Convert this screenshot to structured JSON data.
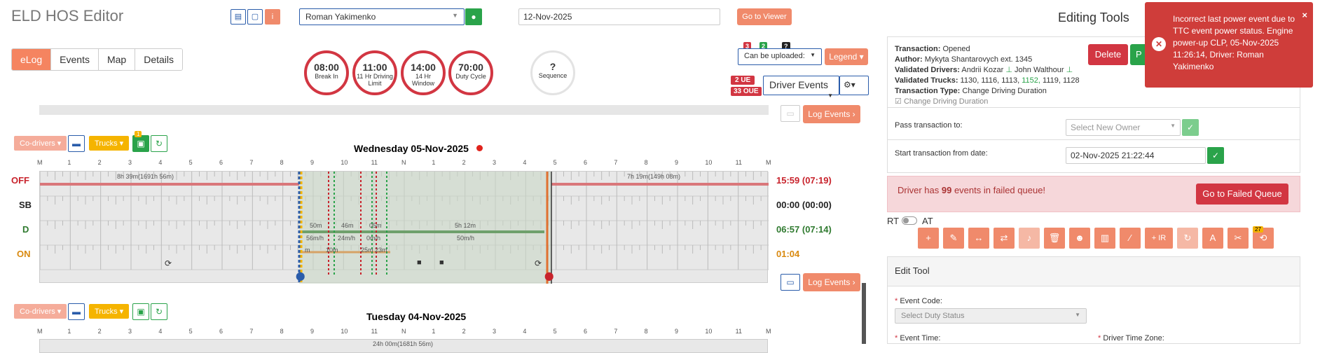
{
  "app_title": "ELD HOS Editor",
  "header": {
    "driver": "Roman Yakimenko",
    "date": "12-Nov-2025",
    "go_viewer": "Go to Viewer"
  },
  "tabs": [
    "eLog",
    "Events",
    "Map",
    "Details"
  ],
  "clocks": [
    {
      "value": "08:00",
      "label": "Break In"
    },
    {
      "value": "11:00",
      "label": "11 Hr Driving Limit"
    },
    {
      "value": "14:00",
      "label": "14 Hr Window"
    },
    {
      "value": "70:00",
      "label": "Duty Cycle"
    }
  ],
  "sequence": {
    "value": "?",
    "label": "Sequence"
  },
  "upload": {
    "badge_red": "3",
    "badge_green": "2",
    "badge_q": "?",
    "select": "Can be uploaded:",
    "legend": "Legend"
  },
  "ue": {
    "ue": "2 UE",
    "oue": "33 OUE",
    "driver_events": "Driver Events"
  },
  "log_events": "Log Events",
  "day1": {
    "title": "Wednesday 05-Nov-2025",
    "hours": [
      "M",
      "1",
      "2",
      "3",
      "4",
      "5",
      "6",
      "7",
      "8",
      "9",
      "10",
      "11",
      "N",
      "1",
      "2",
      "3",
      "4",
      "5",
      "6",
      "7",
      "8",
      "9",
      "10",
      "11",
      "M"
    ],
    "rows": [
      "OFF",
      "SB",
      "D",
      "ON"
    ],
    "off_total": "15:59 (07:19)",
    "sb_total": "00:00 (00:00)",
    "d_total": "06:57 (07:14)",
    "on_total": "01:04",
    "off_left": "8h 39m(1691h 56m)",
    "off_right": "7h 19m(149h 08m)",
    "d_labels": [
      "50m",
      "46m",
      "05m",
      "5h 12m"
    ],
    "speed_labels": [
      "56m/h",
      "24m/h",
      "0m/h",
      "50m/h"
    ],
    "on_labels": [
      "m",
      "10m",
      "25m",
      "23m"
    ]
  },
  "controls": {
    "codrivers": "Co-drivers",
    "trucks": "Trucks",
    "badge": "1"
  },
  "day2": {
    "title": "Tuesday 04-Nov-2025",
    "off_left": "24h 00m(1681h 56m)"
  },
  "editing_tools": "Editing Tools",
  "transaction": {
    "status_label": "Transaction:",
    "status": "Opened",
    "author_label": "Author:",
    "author": "Mykyta Shantarovych ext. 1345",
    "vdrivers_label": "Validated Drivers:",
    "vdrivers": "Andrii Kozar",
    "vdrivers2": "John Walthour",
    "vtrucks_label": "Validated Trucks:",
    "vtrucks_a": "1130, 1116, 1113,",
    "vtrucks_b": "1152,",
    "vtrucks_c": "1119, 1128",
    "type_label": "Transaction Type:",
    "type": "Change Driving Duration",
    "checkbox": "Change Driving Duration",
    "delete": "Delete",
    "publish": "P"
  },
  "pass": {
    "label": "Pass transaction to:",
    "placeholder": "Select New Owner"
  },
  "start": {
    "label": "Start transaction from date:",
    "value": "02-Nov-2025 21:22:44"
  },
  "failed": {
    "text_a": "Driver has ",
    "count": "99",
    "text_b": " events in failed queue!",
    "btn": "Go to Failed Queue"
  },
  "rt": "RT",
  "at": "AT",
  "tool_badge": "27",
  "edit_tool": {
    "title": "Edit Tool",
    "code_label": "Event Code:",
    "code_placeholder": "Select Duty Status",
    "time_label": "Event Time:",
    "tz_label": "Driver Time Zone:"
  },
  "toast": "Incorrect last power event due to TTC event power status. Engine power-up CLP, 05-Nov-2025 11:26:14, Driver: Roman Yakimenko"
}
